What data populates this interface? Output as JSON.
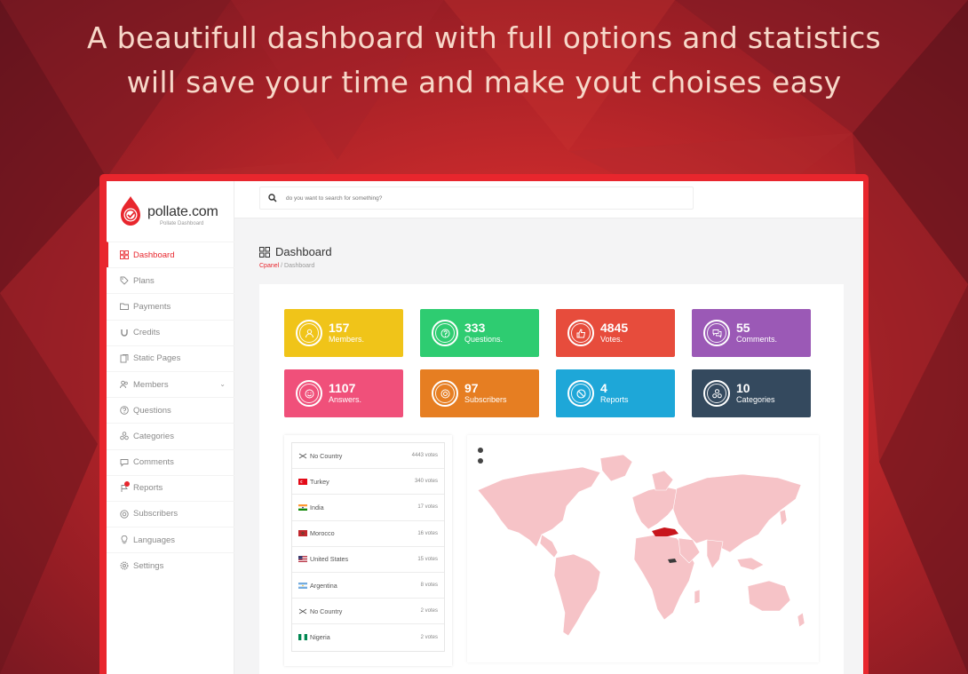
{
  "headline": {
    "line1": "A beautifull dashboard with full options and statistics",
    "line2": "will save your time and make yout choises easy"
  },
  "logo": {
    "name": "pollate.com",
    "subtitle": "Pollate Dashboard"
  },
  "search": {
    "placeholder": "do you want to search for something?"
  },
  "sidebar": {
    "items": [
      {
        "label": "Dashboard",
        "icon": "grid-icon",
        "active": true
      },
      {
        "label": "Plans",
        "icon": "tag-icon"
      },
      {
        "label": "Payments",
        "icon": "folder-icon"
      },
      {
        "label": "Credits",
        "icon": "magnet-icon"
      },
      {
        "label": "Static Pages",
        "icon": "pages-icon"
      },
      {
        "label": "Members",
        "icon": "users-icon",
        "expandable": true
      },
      {
        "label": "Questions",
        "icon": "question-icon"
      },
      {
        "label": "Categories",
        "icon": "categories-icon"
      },
      {
        "label": "Comments",
        "icon": "comment-icon"
      },
      {
        "label": "Reports",
        "icon": "flag-icon",
        "badge": true
      },
      {
        "label": "Subscribers",
        "icon": "lifebuoy-icon"
      },
      {
        "label": "Languages",
        "icon": "bulb-icon"
      },
      {
        "label": "Settings",
        "icon": "settings-icon"
      }
    ]
  },
  "page": {
    "title": "Dashboard",
    "breadcrumb_root": "Cpanel",
    "breadcrumb_sep": " / ",
    "breadcrumb_current": "Dashboard"
  },
  "stats": [
    {
      "value": "157",
      "label": "Members.",
      "color": "#f0c419",
      "icon": "user-icon"
    },
    {
      "value": "333",
      "label": "Questions.",
      "color": "#2ecc71",
      "icon": "question-icon"
    },
    {
      "value": "4845",
      "label": "Votes.",
      "color": "#e74c3c",
      "icon": "thumbs-up-icon"
    },
    {
      "value": "55",
      "label": "Comments.",
      "color": "#9b59b6",
      "icon": "comments-icon"
    },
    {
      "value": "1107",
      "label": "Answers.",
      "color": "#f0507a",
      "icon": "smile-icon"
    },
    {
      "value": "97",
      "label": "Subscribers",
      "color": "#e67e22",
      "icon": "lifebuoy-icon"
    },
    {
      "value": "4",
      "label": "Reports",
      "color": "#1ea7d8",
      "icon": "ban-icon"
    },
    {
      "value": "10",
      "label": "Categories",
      "color": "#34495e",
      "icon": "categories-icon"
    }
  ],
  "countries": [
    {
      "name": "No Country",
      "votes": "4443 votes",
      "flag": "none"
    },
    {
      "name": "Turkey",
      "votes": "340 votes",
      "flag": "tr"
    },
    {
      "name": "India",
      "votes": "17 votes",
      "flag": "in"
    },
    {
      "name": "Morocco",
      "votes": "16 votes",
      "flag": "ma"
    },
    {
      "name": "United States",
      "votes": "15 votes",
      "flag": "us"
    },
    {
      "name": "Argentina",
      "votes": "8 votes",
      "flag": "ar"
    },
    {
      "name": "No Country",
      "votes": "2 votes",
      "flag": "none"
    },
    {
      "name": "Nigeria",
      "votes": "2 votes",
      "flag": "ng"
    }
  ],
  "map": {
    "base_color": "#f6c3c7",
    "highlight_color": "#c8151c",
    "highlighted": [
      "Turkey"
    ]
  }
}
